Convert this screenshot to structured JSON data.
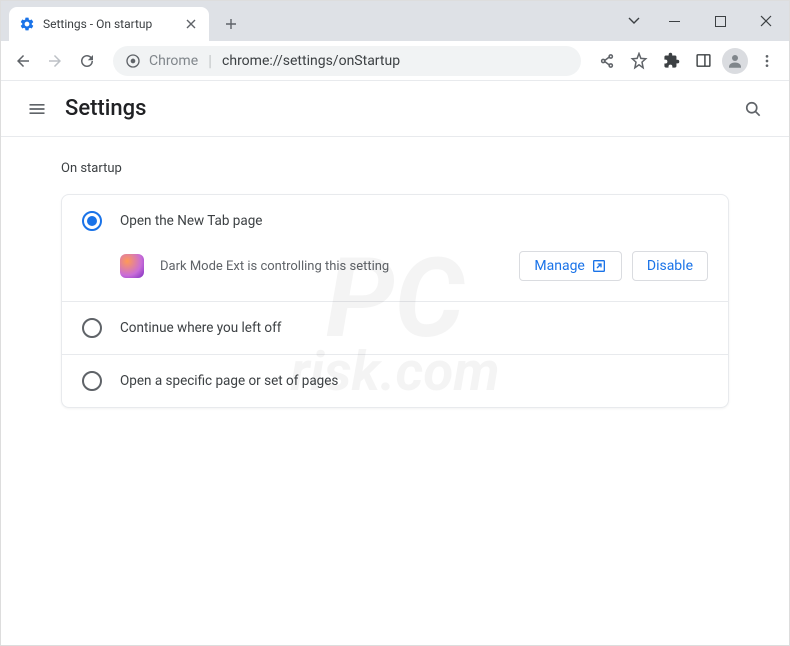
{
  "window": {
    "tab_title": "Settings - On startup"
  },
  "omnibox": {
    "scheme_label": "Chrome",
    "url": "chrome://settings/onStartup"
  },
  "header": {
    "title": "Settings"
  },
  "section": {
    "title": "On startup",
    "options": {
      "new_tab": "Open the New Tab page",
      "continue": "Continue where you left off",
      "specific": "Open a specific page or set of pages"
    },
    "extension_notice": "Dark Mode Ext is controlling this setting",
    "manage_label": "Manage",
    "disable_label": "Disable"
  },
  "watermark": {
    "line1": "PC",
    "line2": "risk.com"
  }
}
